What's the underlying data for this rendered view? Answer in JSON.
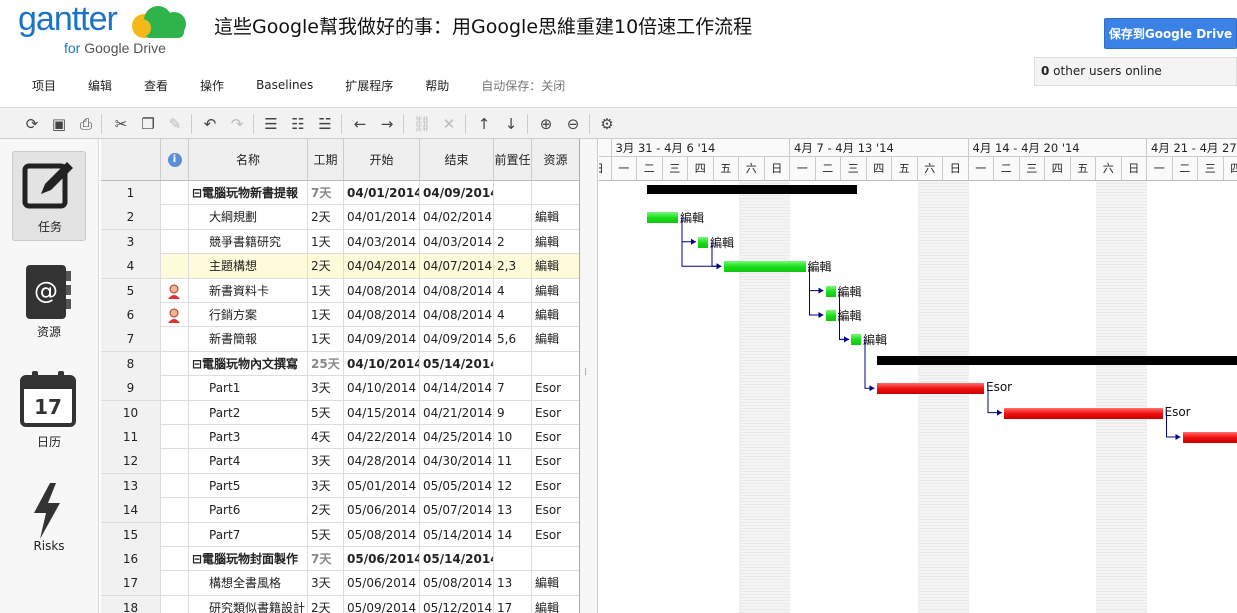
{
  "logo": {
    "brand": "gantter",
    "sub_for": "for",
    "sub_drive": "Google Drive"
  },
  "title": "這些Google幫我做好的事：用Google思維重建10倍速工作流程",
  "save_button": "保存到Google Drive",
  "online": {
    "count": "0",
    "text": " other users online"
  },
  "menu": [
    "项目",
    "编辑",
    "查看",
    "操作",
    "Baselines",
    "扩展程序",
    "帮助"
  ],
  "autosave": "自动保存：关闭",
  "toolbar_icons": [
    "refresh-icon",
    "save-icon",
    "print-icon",
    "cut-icon",
    "copy-icon",
    "paint-icon",
    "undo-icon",
    "redo-icon",
    "indent-icon",
    "outdent-icon",
    "notes-icon",
    "arrow-left-icon",
    "arrow-right-icon",
    "link-icon",
    "unlink-icon",
    "move-up-icon",
    "move-down-icon",
    "zoom-in-icon",
    "zoom-out-icon",
    "settings-icon"
  ],
  "sidebar": [
    {
      "label": "任务",
      "icon": "task-icon"
    },
    {
      "label": "资源",
      "icon": "resource-icon"
    },
    {
      "label": "日历",
      "icon": "calendar-icon",
      "day": "17"
    },
    {
      "label": "Risks",
      "icon": "risk-icon"
    }
  ],
  "columns": [
    "名称",
    "工期",
    "开始",
    "结束",
    "前置任",
    "资源"
  ],
  "rows": [
    {
      "n": "1",
      "name": "⊟電腦玩物新書提報",
      "dur": "7天",
      "start": "04/01/2014",
      "end": "04/09/2014",
      "pred": "",
      "res": "",
      "summary": true,
      "icon": ""
    },
    {
      "n": "2",
      "name": "大綱規劃",
      "dur": "2天",
      "start": "04/01/2014",
      "end": "04/02/2014",
      "pred": "",
      "res": "編輯",
      "icon": ""
    },
    {
      "n": "3",
      "name": "競爭書籍研究",
      "dur": "1天",
      "start": "04/03/2014",
      "end": "04/03/2014",
      "pred": "2",
      "res": "編輯",
      "icon": ""
    },
    {
      "n": "4",
      "name": "主題構想",
      "dur": "2天",
      "start": "04/04/2014",
      "end": "04/07/2014",
      "pred": "2,3",
      "res": "編輯",
      "icon": "",
      "selected": true
    },
    {
      "n": "5",
      "name": "新書資料卡",
      "dur": "1天",
      "start": "04/08/2014",
      "end": "04/08/2014",
      "pred": "4",
      "res": "編輯",
      "icon": "person"
    },
    {
      "n": "6",
      "name": "行銷方案",
      "dur": "1天",
      "start": "04/08/2014",
      "end": "04/08/2014",
      "pred": "4",
      "res": "編輯",
      "icon": "person"
    },
    {
      "n": "7",
      "name": "新書簡報",
      "dur": "1天",
      "start": "04/09/2014",
      "end": "04/09/2014",
      "pred": "5,6",
      "res": "編輯",
      "icon": ""
    },
    {
      "n": "8",
      "name": "⊟電腦玩物內文撰寫",
      "dur": "25天",
      "start": "04/10/2014",
      "end": "05/14/2014",
      "pred": "",
      "res": "",
      "summary": true,
      "icon": ""
    },
    {
      "n": "9",
      "name": "Part1",
      "dur": "3天",
      "start": "04/10/2014",
      "end": "04/14/2014",
      "pred": "7",
      "res": "Esor",
      "icon": ""
    },
    {
      "n": "10",
      "name": "Part2",
      "dur": "5天",
      "start": "04/15/2014",
      "end": "04/21/2014",
      "pred": "9",
      "res": "Esor",
      "icon": ""
    },
    {
      "n": "11",
      "name": "Part3",
      "dur": "4天",
      "start": "04/22/2014",
      "end": "04/25/2014",
      "pred": "10",
      "res": "Esor",
      "icon": ""
    },
    {
      "n": "12",
      "name": "Part4",
      "dur": "3天",
      "start": "04/28/2014",
      "end": "04/30/2014",
      "pred": "11",
      "res": "Esor",
      "icon": ""
    },
    {
      "n": "13",
      "name": "Part5",
      "dur": "3天",
      "start": "05/01/2014",
      "end": "05/05/2014",
      "pred": "12",
      "res": "Esor",
      "icon": ""
    },
    {
      "n": "14",
      "name": "Part6",
      "dur": "2天",
      "start": "05/06/2014",
      "end": "05/07/2014",
      "pred": "13",
      "res": "Esor",
      "icon": ""
    },
    {
      "n": "15",
      "name": "Part7",
      "dur": "5天",
      "start": "05/08/2014",
      "end": "05/14/2014",
      "pred": "14",
      "res": "Esor",
      "icon": ""
    },
    {
      "n": "16",
      "name": "⊟電腦玩物封面製作",
      "dur": "7天",
      "start": "05/06/2014",
      "end": "05/14/2014",
      "pred": "",
      "res": "",
      "summary": true,
      "icon": ""
    },
    {
      "n": "17",
      "name": "構想全書風格",
      "dur": "3天",
      "start": "05/06/2014",
      "end": "05/08/2014",
      "pred": "13",
      "res": "編輯",
      "icon": ""
    },
    {
      "n": "18",
      "name": "研究類似書籍設計",
      "dur": "2天",
      "start": "05/09/2014",
      "end": "05/12/2014",
      "pred": "17",
      "res": "編輯",
      "icon": ""
    }
  ],
  "gantt": {
    "weeks": [
      "3月 31 - 4月 6 '14",
      "4月 7 - 4月 13 '14",
      "4月 14 - 4月 20 '14",
      "4月 21 - 4月 27 '14"
    ],
    "days": [
      "日",
      "一",
      "二",
      "三",
      "四",
      "五",
      "六",
      "日",
      "一",
      "二",
      "三",
      "四",
      "五",
      "六",
      "日",
      "一",
      "二",
      "三",
      "四",
      "五",
      "六",
      "日",
      "一",
      "二",
      "三",
      "四"
    ],
    "bar_labels": [
      "編輯",
      "編輯",
      "編輯",
      "編輯",
      "編輯",
      "編輯",
      "Esor",
      "Esor"
    ],
    "colors": {
      "normal": "#19e019",
      "critical": "#f01010",
      "summary": "#000000",
      "link": "#00008b"
    }
  }
}
